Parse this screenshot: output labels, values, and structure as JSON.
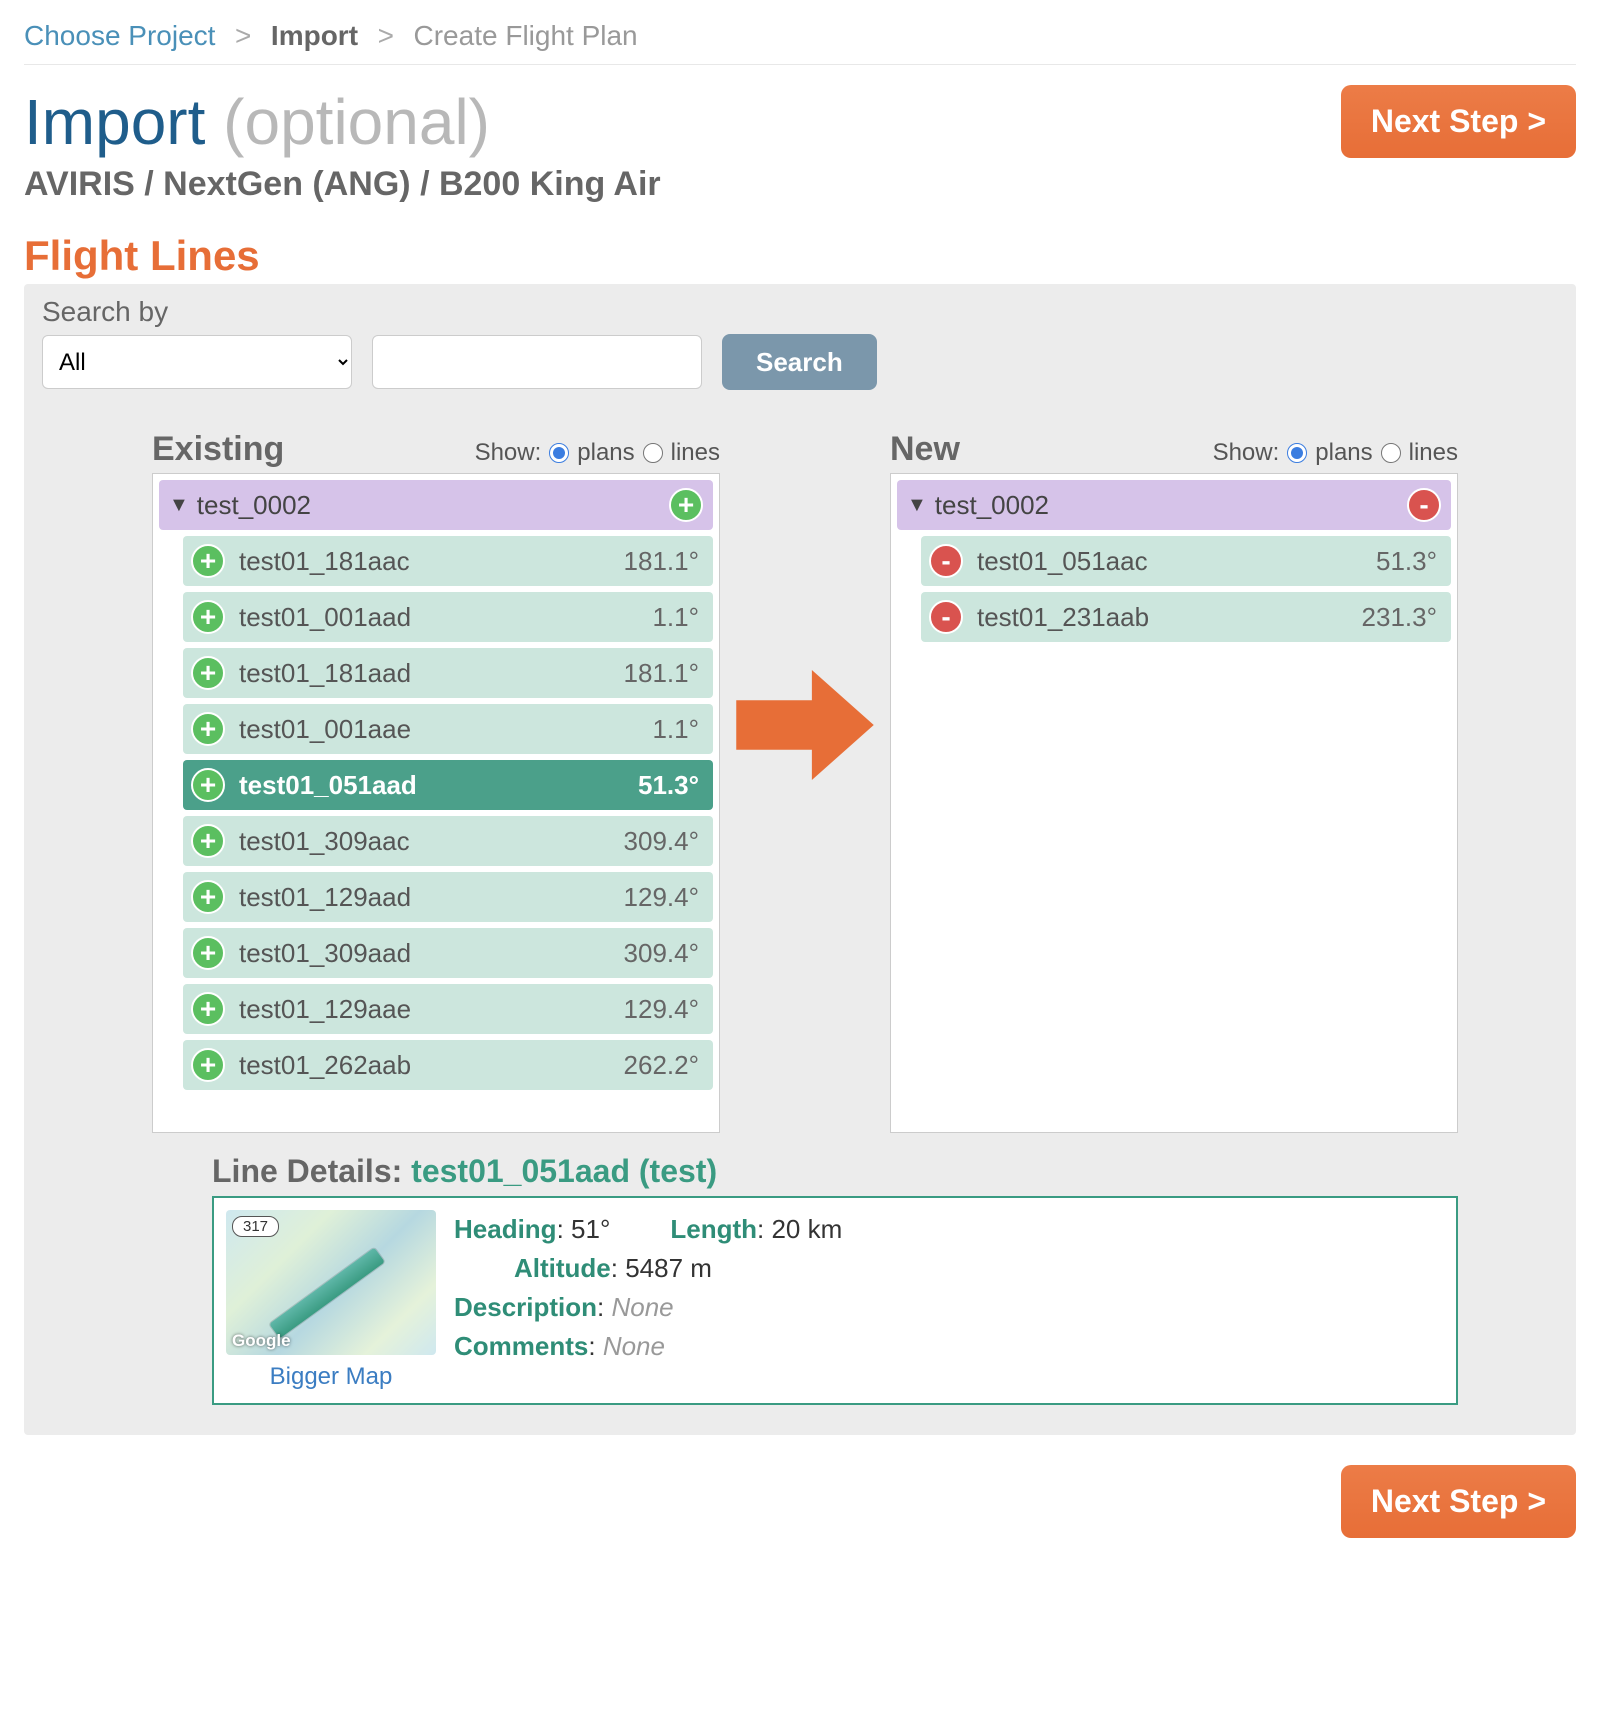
{
  "breadcrumb": {
    "choose_project": "Choose Project",
    "import": "Import",
    "create": "Create Flight Plan"
  },
  "page": {
    "title": "Import",
    "optional": "(optional)",
    "subtitle": "AVIRIS / NextGen (ANG) / B200 King Air",
    "next_step": "Next Step >"
  },
  "section_heading": "Flight Lines",
  "search": {
    "label": "Search by",
    "select_value": "All",
    "input_value": "",
    "button": "Search"
  },
  "existing": {
    "title": "Existing",
    "show_label": "Show:",
    "opt_plans": "plans",
    "opt_lines": "lines",
    "group": "test_0002",
    "items": [
      {
        "name": "test01_181aac",
        "deg": "181.1°",
        "selected": false
      },
      {
        "name": "test01_001aad",
        "deg": "1.1°",
        "selected": false
      },
      {
        "name": "test01_181aad",
        "deg": "181.1°",
        "selected": false
      },
      {
        "name": "test01_001aae",
        "deg": "1.1°",
        "selected": false
      },
      {
        "name": "test01_051aad",
        "deg": "51.3°",
        "selected": true
      },
      {
        "name": "test01_309aac",
        "deg": "309.4°",
        "selected": false
      },
      {
        "name": "test01_129aad",
        "deg": "129.4°",
        "selected": false
      },
      {
        "name": "test01_309aad",
        "deg": "309.4°",
        "selected": false
      },
      {
        "name": "test01_129aae",
        "deg": "129.4°",
        "selected": false
      },
      {
        "name": "test01_262aab",
        "deg": "262.2°",
        "selected": false
      }
    ]
  },
  "new": {
    "title": "New",
    "show_label": "Show:",
    "opt_plans": "plans",
    "opt_lines": "lines",
    "group": "test_0002",
    "items": [
      {
        "name": "test01_051aac",
        "deg": "51.3°"
      },
      {
        "name": "test01_231aab",
        "deg": "231.3°"
      }
    ]
  },
  "details": {
    "title_label": "Line Details:",
    "line_name": "test01_051aad (test)",
    "heading_label": "Heading",
    "heading_value": "51°",
    "length_label": "Length",
    "length_value": "20 km",
    "altitude_label": "Altitude",
    "altitude_value": "5487 m",
    "description_label": "Description",
    "description_value": "None",
    "comments_label": "Comments",
    "comments_value": "None",
    "bigger_map": "Bigger Map",
    "map_badge_317": "317",
    "map_badge_google": "Google"
  }
}
